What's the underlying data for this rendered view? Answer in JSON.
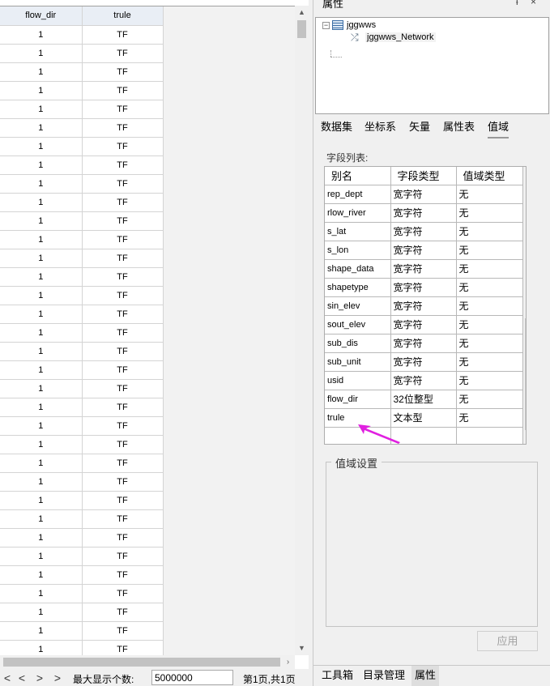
{
  "grid": {
    "columns": [
      "flow_dir",
      "trule"
    ],
    "rows": [
      [
        "1",
        "TF"
      ],
      [
        "1",
        "TF"
      ],
      [
        "1",
        "TF"
      ],
      [
        "1",
        "TF"
      ],
      [
        "1",
        "TF"
      ],
      [
        "1",
        "TF"
      ],
      [
        "1",
        "TF"
      ],
      [
        "1",
        "TF"
      ],
      [
        "1",
        "TF"
      ],
      [
        "1",
        "TF"
      ],
      [
        "1",
        "TF"
      ],
      [
        "1",
        "TF"
      ],
      [
        "1",
        "TF"
      ],
      [
        "1",
        "TF"
      ],
      [
        "1",
        "TF"
      ],
      [
        "1",
        "TF"
      ],
      [
        "1",
        "TF"
      ],
      [
        "1",
        "TF"
      ],
      [
        "1",
        "TF"
      ],
      [
        "1",
        "TF"
      ],
      [
        "1",
        "TF"
      ],
      [
        "1",
        "TF"
      ],
      [
        "1",
        "TF"
      ],
      [
        "1",
        "TF"
      ],
      [
        "1",
        "TF"
      ],
      [
        "1",
        "TF"
      ],
      [
        "1",
        "TF"
      ],
      [
        "1",
        "TF"
      ],
      [
        "1",
        "TF"
      ],
      [
        "1",
        "TF"
      ],
      [
        "1",
        "TF"
      ],
      [
        "1",
        "TF"
      ],
      [
        "1",
        "TF"
      ],
      [
        "1",
        "TF"
      ]
    ]
  },
  "pager": {
    "buttons": [
      "<",
      "<",
      ">",
      ">"
    ],
    "max_label": "最大显示个数:",
    "max_value": "5000000",
    "pages": "第1页,共1页"
  },
  "panel": {
    "title": "属性",
    "pin": "ᵼ",
    "close": "×"
  },
  "tree": {
    "root": "jggwws",
    "child": "jggwws_Network"
  },
  "tabs": [
    "数据集",
    "坐标系",
    "矢量",
    "属性表",
    "值域"
  ],
  "fields": {
    "label": "字段列表:",
    "headers": [
      "别名",
      "字段类型",
      "值域类型"
    ],
    "rows": [
      [
        "rep_dept",
        "宽字符",
        "无"
      ],
      [
        "rlow_river",
        "宽字符",
        "无"
      ],
      [
        "s_lat",
        "宽字符",
        "无"
      ],
      [
        "s_lon",
        "宽字符",
        "无"
      ],
      [
        "shape_data",
        "宽字符",
        "无"
      ],
      [
        "shapetype",
        "宽字符",
        "无"
      ],
      [
        "sin_elev",
        "宽字符",
        "无"
      ],
      [
        "sout_elev",
        "宽字符",
        "无"
      ],
      [
        "sub_dis",
        "宽字符",
        "无"
      ],
      [
        "sub_unit",
        "宽字符",
        "无"
      ],
      [
        "usid",
        "宽字符",
        "无"
      ],
      [
        "flow_dir",
        "32位整型",
        "无"
      ],
      [
        "trule",
        "文本型",
        "无"
      ]
    ]
  },
  "range": {
    "title": "值域设置",
    "apply": "应用"
  },
  "bottom_tabs": [
    "工具箱",
    "目录管理",
    "属性"
  ],
  "colors": {
    "arrow": "#e020e0",
    "header_bg": "#e9eef5"
  }
}
